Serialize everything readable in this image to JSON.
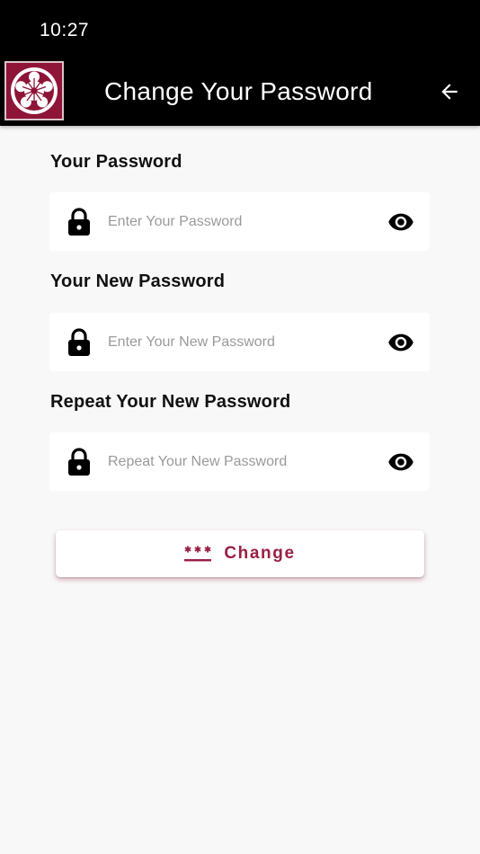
{
  "status_bar": {
    "time": "10:27"
  },
  "app_bar": {
    "title": "Change Your Password",
    "logo_icon": "flower-crest-icon",
    "back_icon": "arrow-left-icon"
  },
  "form": {
    "fields": [
      {
        "label": "Your Password",
        "placeholder": "Enter Your Password",
        "value": "",
        "leading_icon": "lock-icon",
        "trailing_icon": "eye-icon"
      },
      {
        "label": "Your New Password",
        "placeholder": "Enter Your New Password",
        "value": "",
        "leading_icon": "lock-icon",
        "trailing_icon": "eye-icon"
      },
      {
        "label": "Repeat Your New Password",
        "placeholder": "Repeat Your New Password",
        "value": "",
        "leading_icon": "lock-icon",
        "trailing_icon": "eye-icon"
      }
    ],
    "submit": {
      "label": "Change",
      "icon": "password-icon"
    }
  },
  "colors": {
    "brand": "#8e1538",
    "accent_text": "#9a1f44",
    "app_bar": "#000000",
    "background": "#f8f8f8"
  }
}
